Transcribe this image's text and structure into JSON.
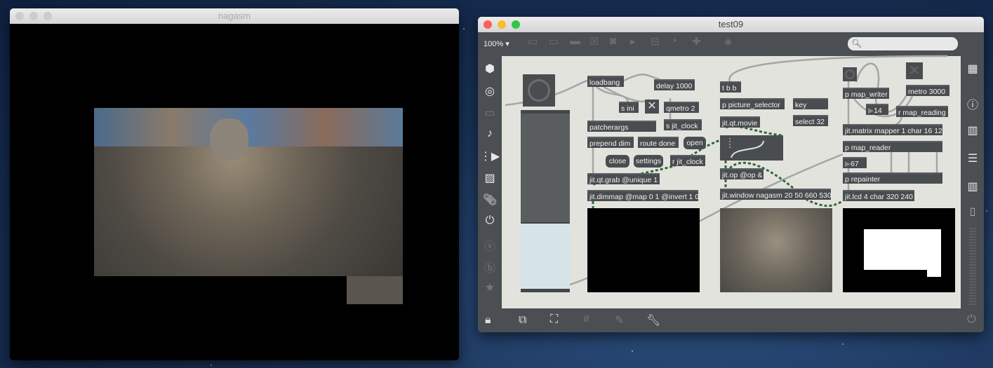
{
  "left_window": {
    "title": "nagasm"
  },
  "right_window": {
    "title": "test09",
    "zoom": "100%",
    "search_placeholder": ""
  },
  "objects": {
    "loadbang": "loadbang",
    "delay": "delay 1000",
    "s_ini": "s ini",
    "qmetro": "qmetro 2",
    "s_jit_clock": "s jit_clock",
    "patcherargs": "patcherargs",
    "prepend_dim": "prepend dim",
    "route_done": "route done",
    "open": "open",
    "close": "close",
    "settings": "settings",
    "r_jit_clock": "r jit_clock",
    "grab": "jit.qt.grab @unique 1",
    "dimmap": "jit.dimmap @map 0 1 @invert 1 0",
    "tbb": "t b b",
    "picture_selector": "p picture_selector",
    "key": "key",
    "select": "select 32",
    "movie": "jit.qt.movie",
    "op": "jit.op @op &",
    "window": "jit.window nagasm 20 50 660 530",
    "map_writer": "p map_writer",
    "metro": "metro 3000",
    "num14": "14",
    "r_map_reading": "r map_reading",
    "matrix": "jit.matrix mapper 1 char 16 12",
    "map_reader": "p map_reader",
    "num67": "67",
    "repainter": "p repainter",
    "lcd": "jit.lcd 4 char 320 240"
  },
  "colors": {
    "patcher_bg": "#e3e3de",
    "object": "#4a4d50",
    "toolbar": "#4b4f53"
  }
}
